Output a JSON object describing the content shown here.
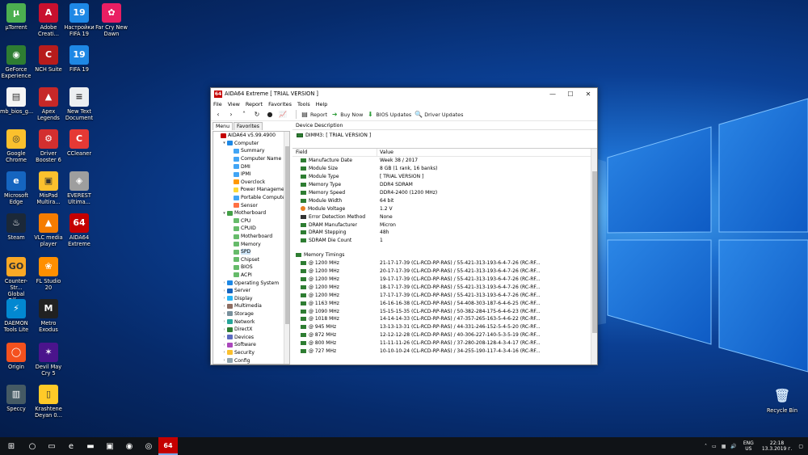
{
  "desktop": {
    "icons": [
      {
        "name": "μTorrent",
        "color": "#4caf50",
        "glyph": "µ"
      },
      {
        "name": "Adobe\nCreati...",
        "color": "#c8102e",
        "glyph": "A"
      },
      {
        "name": "Настройки\nFIFA 19",
        "color": "#1e88e5",
        "glyph": "19"
      },
      {
        "name": "Far Cry New\nDawn",
        "color": "#e91e63",
        "glyph": "✿"
      },
      {
        "name": "GeForce\nExperience",
        "color": "#2e7d32",
        "glyph": "◉"
      },
      {
        "name": "NCH Suite",
        "color": "#b71c1c",
        "glyph": "C"
      },
      {
        "name": "FIFA 19",
        "color": "#1e88e5",
        "glyph": "19"
      },
      {
        "name": "mb_bios_g...",
        "color": "#f5f5f5",
        "glyph": "▤"
      },
      {
        "name": "Apex\nLegends",
        "color": "#c62828",
        "glyph": "▲"
      },
      {
        "name": "New Text\nDocument",
        "color": "#eceff1",
        "glyph": "≡"
      },
      {
        "name": "Google\nChrome",
        "color": "#fbc02d",
        "glyph": "◎"
      },
      {
        "name": "Driver\nBooster 6",
        "color": "#d32f2f",
        "glyph": "⚙"
      },
      {
        "name": "CCleaner",
        "color": "#e53935",
        "glyph": "C"
      },
      {
        "name": "Microsoft\nEdge",
        "color": "#1565c0",
        "glyph": "e"
      },
      {
        "name": "MisPad\nMultira...",
        "color": "#fbc02d",
        "glyph": "▣"
      },
      {
        "name": "EVEREST\nUltima...",
        "color": "#9e9e9e",
        "glyph": "◈"
      },
      {
        "name": "Steam",
        "color": "#1b2838",
        "glyph": "♨"
      },
      {
        "name": "VLC media\nplayer",
        "color": "#f57c00",
        "glyph": "▲"
      },
      {
        "name": "AIDA64\nExtreme",
        "color": "#c40000",
        "glyph": "64"
      },
      {
        "name": "Counter-Str...\nGlobal Offe...",
        "color": "#f9a825",
        "glyph": "GO"
      },
      {
        "name": "FL Studio 20",
        "color": "#ff8f00",
        "glyph": "❀"
      },
      {
        "name": "DAEMON\nTools Lite",
        "color": "#0288d1",
        "glyph": "⚡"
      },
      {
        "name": "Metro Exodus",
        "color": "#212121",
        "glyph": "M"
      },
      {
        "name": "Origin",
        "color": "#f4511e",
        "glyph": "◯"
      },
      {
        "name": "Devil May\nCry 5",
        "color": "#4a148c",
        "glyph": "✶"
      },
      {
        "name": "Speccy",
        "color": "#455a64",
        "glyph": "▥"
      },
      {
        "name": "Krashtene\nDeyan 0...",
        "color": "#ffca28",
        "glyph": "▯"
      }
    ],
    "recycle_bin": "Recycle Bin"
  },
  "window": {
    "title": "AIDA64 Extreme  [ TRIAL VERSION ]",
    "menu": [
      "File",
      "View",
      "Report",
      "Favorites",
      "Tools",
      "Help"
    ],
    "toolbar": {
      "report": "Report",
      "buy_now": "Buy Now",
      "bios_updates": "BIOS Updates",
      "driver_updates": "Driver Updates"
    },
    "tabs": {
      "menu": "Menu",
      "favorites": "Favorites"
    },
    "tree": [
      {
        "label": "AIDA64 v5.99.4900",
        "level": 0,
        "exp": "",
        "color": "#c40000"
      },
      {
        "label": "Computer",
        "level": 1,
        "exp": "▾",
        "color": "#1e88e5"
      },
      {
        "label": "Summary",
        "level": 2,
        "exp": "",
        "color": "#42a5f5"
      },
      {
        "label": "Computer Name",
        "level": 2,
        "exp": "",
        "color": "#42a5f5"
      },
      {
        "label": "DMI",
        "level": 2,
        "exp": "",
        "color": "#42a5f5"
      },
      {
        "label": "IPMI",
        "level": 2,
        "exp": "",
        "color": "#42a5f5"
      },
      {
        "label": "Overclock",
        "level": 2,
        "exp": "",
        "color": "#ff9800"
      },
      {
        "label": "Power Management",
        "level": 2,
        "exp": "",
        "color": "#fdd835"
      },
      {
        "label": "Portable Computer",
        "level": 2,
        "exp": "",
        "color": "#42a5f5"
      },
      {
        "label": "Sensor",
        "level": 2,
        "exp": "",
        "color": "#ff7043"
      },
      {
        "label": "Motherboard",
        "level": 1,
        "exp": "▾",
        "color": "#43a047"
      },
      {
        "label": "CPU",
        "level": 2,
        "exp": "",
        "color": "#66bb6a"
      },
      {
        "label": "CPUID",
        "level": 2,
        "exp": "",
        "color": "#66bb6a"
      },
      {
        "label": "Motherboard",
        "level": 2,
        "exp": "",
        "color": "#66bb6a"
      },
      {
        "label": "Memory",
        "level": 2,
        "exp": "",
        "color": "#66bb6a"
      },
      {
        "label": "SPD",
        "level": 2,
        "exp": "",
        "color": "#66bb6a",
        "selected": true
      },
      {
        "label": "Chipset",
        "level": 2,
        "exp": "",
        "color": "#66bb6a"
      },
      {
        "label": "BIOS",
        "level": 2,
        "exp": "",
        "color": "#66bb6a"
      },
      {
        "label": "ACPI",
        "level": 2,
        "exp": "",
        "color": "#66bb6a"
      },
      {
        "label": "Operating System",
        "level": 1,
        "exp": "›",
        "color": "#1e88e5"
      },
      {
        "label": "Server",
        "level": 1,
        "exp": "›",
        "color": "#1565c0"
      },
      {
        "label": "Display",
        "level": 1,
        "exp": "›",
        "color": "#29b6f6"
      },
      {
        "label": "Multimedia",
        "level": 1,
        "exp": "›",
        "color": "#8d6e63"
      },
      {
        "label": "Storage",
        "level": 1,
        "exp": "›",
        "color": "#78909c"
      },
      {
        "label": "Network",
        "level": 1,
        "exp": "›",
        "color": "#26a69a"
      },
      {
        "label": "DirectX",
        "level": 1,
        "exp": "›",
        "color": "#2e7d32"
      },
      {
        "label": "Devices",
        "level": 1,
        "exp": "›",
        "color": "#5c6bc0"
      },
      {
        "label": "Software",
        "level": 1,
        "exp": "›",
        "color": "#ab47bc"
      },
      {
        "label": "Security",
        "level": 1,
        "exp": "›",
        "color": "#fbc02d"
      },
      {
        "label": "Config",
        "level": 1,
        "exp": "›",
        "color": "#90a4ae"
      }
    ],
    "device_description_header": "Device Description",
    "device": "DIMM3: [ TRIAL VERSION ]",
    "columns": {
      "field": "Field",
      "value": "Value"
    },
    "properties": [
      {
        "field": "Manufacture Date",
        "value": "Week 38 / 2017",
        "icon": "chip"
      },
      {
        "field": "Module Size",
        "value": "8 GB (1 rank, 16 banks)",
        "icon": "chip"
      },
      {
        "field": "Module Type",
        "value": "[ TRIAL VERSION ]",
        "icon": "chip"
      },
      {
        "field": "Memory Type",
        "value": "DDR4 SDRAM",
        "icon": "chip"
      },
      {
        "field": "Memory Speed",
        "value": "DDR4-2400 (1200 MHz)",
        "icon": "chip"
      },
      {
        "field": "Module Width",
        "value": "64 bit",
        "icon": "chip"
      },
      {
        "field": "Module Voltage",
        "value": "1.2 V",
        "icon": "warn"
      },
      {
        "field": "Error Detection Method",
        "value": "None",
        "icon": "err"
      },
      {
        "field": "DRAM Manufacturer",
        "value": "Micron",
        "icon": "chip"
      },
      {
        "field": "DRAM Stepping",
        "value": "48h",
        "icon": "chip"
      },
      {
        "field": "SDRAM Die Count",
        "value": "1",
        "icon": "chip"
      }
    ],
    "timings_section": "Memory Timings",
    "timings": [
      {
        "field": "@ 1200 MHz",
        "value": "21-17-17-39  (CL-RCD-RP-RAS) / 55-421-313-193-6-4-7-26  (RC-RF..."
      },
      {
        "field": "@ 1200 MHz",
        "value": "20-17-17-39  (CL-RCD-RP-RAS) / 55-421-313-193-6-4-7-26  (RC-RF..."
      },
      {
        "field": "@ 1200 MHz",
        "value": "19-17-17-39  (CL-RCD-RP-RAS) / 55-421-313-193-6-4-7-26  (RC-RF..."
      },
      {
        "field": "@ 1200 MHz",
        "value": "18-17-17-39  (CL-RCD-RP-RAS) / 55-421-313-193-6-4-7-26  (RC-RF..."
      },
      {
        "field": "@ 1200 MHz",
        "value": "17-17-17-39  (CL-RCD-RP-RAS) / 55-421-313-193-6-4-7-26  (RC-RF..."
      },
      {
        "field": "@ 1163 MHz",
        "value": "16-16-16-38  (CL-RCD-RP-RAS) / 54-408-303-187-6-4-6-25  (RC-RF..."
      },
      {
        "field": "@ 1090 MHz",
        "value": "15-15-15-35  (CL-RCD-RP-RAS) / 50-382-284-175-6-4-6-23  (RC-RF..."
      },
      {
        "field": "@ 1018 MHz",
        "value": "14-14-14-33  (CL-RCD-RP-RAS) / 47-357-265-163-5-4-6-22  (RC-RF..."
      },
      {
        "field": "@ 945 MHz",
        "value": "13-13-13-31  (CL-RCD-RP-RAS) / 44-331-246-152-5-4-5-20  (RC-RF..."
      },
      {
        "field": "@ 872 MHz",
        "value": "12-12-12-28  (CL-RCD-RP-RAS) / 40-306-227-140-5-3-5-19  (RC-RF..."
      },
      {
        "field": "@ 800 MHz",
        "value": "11-11-11-26  (CL-RCD-RP-RAS) / 37-280-208-128-4-3-4-17  (RC-RF..."
      },
      {
        "field": "@ 727 MHz",
        "value": "10-10-10-24  (CL-RCD-RP-RAS) / 34-255-190-117-4-3-4-16  (RC-RF..."
      }
    ]
  },
  "taskbar": {
    "apps": [
      {
        "name": "windows-start",
        "glyph": "⊞"
      },
      {
        "name": "search",
        "glyph": "○"
      },
      {
        "name": "task-view",
        "glyph": "▭"
      },
      {
        "name": "edge",
        "glyph": "e"
      },
      {
        "name": "file-explorer",
        "glyph": "▬"
      },
      {
        "name": "store",
        "glyph": "▣"
      },
      {
        "name": "origin",
        "glyph": "◉"
      },
      {
        "name": "chrome",
        "glyph": "◎"
      },
      {
        "name": "aida64",
        "glyph": "64"
      }
    ],
    "lang_top": "ENG",
    "lang_bottom": "US",
    "time": "22:18",
    "date": "13.3.2019 г."
  }
}
